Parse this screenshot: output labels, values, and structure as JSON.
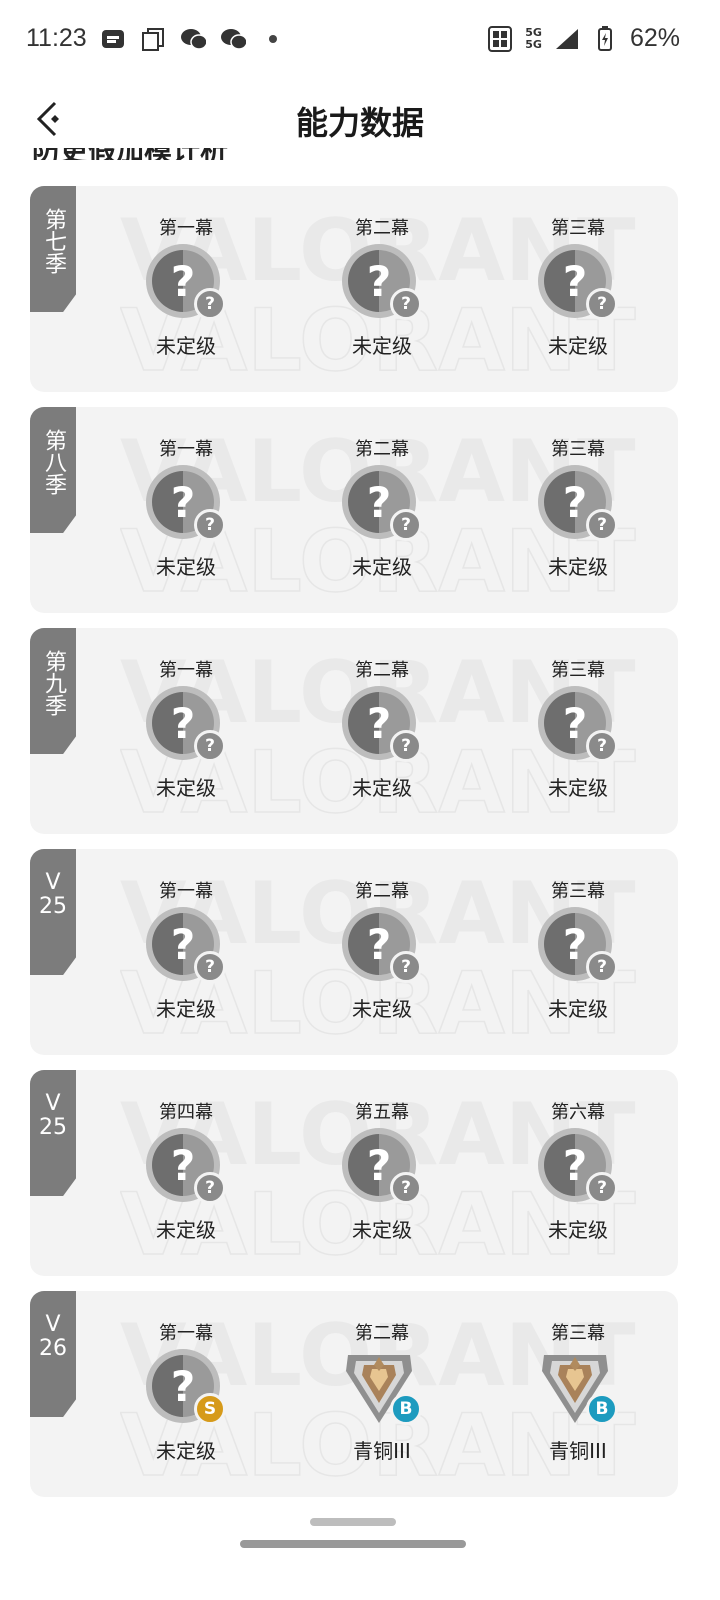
{
  "status": {
    "time": "11:23",
    "battery": "62%",
    "net_top": "5G",
    "net_bottom": "5G",
    "icons": [
      "notification-b-icon",
      "copy-icon",
      "wechat-icon",
      "wechat-icon",
      "dot-icon"
    ]
  },
  "header": {
    "title": "能力数据",
    "cut_text": "防更假加模计析"
  },
  "watermark": "VALORANT",
  "seasons": [
    {
      "tag": "第七季",
      "acts": [
        {
          "label": "第一幕",
          "rank": "未定级",
          "badge": "?"
        },
        {
          "label": "第二幕",
          "rank": "未定级",
          "badge": "?"
        },
        {
          "label": "第三幕",
          "rank": "未定级",
          "badge": "?"
        }
      ]
    },
    {
      "tag": "第八季",
      "acts": [
        {
          "label": "第一幕",
          "rank": "未定级",
          "badge": "?"
        },
        {
          "label": "第二幕",
          "rank": "未定级",
          "badge": "?"
        },
        {
          "label": "第三幕",
          "rank": "未定级",
          "badge": "?"
        }
      ]
    },
    {
      "tag": "第九季",
      "acts": [
        {
          "label": "第一幕",
          "rank": "未定级",
          "badge": "?"
        },
        {
          "label": "第二幕",
          "rank": "未定级",
          "badge": "?"
        },
        {
          "label": "第三幕",
          "rank": "未定级",
          "badge": "?"
        }
      ]
    },
    {
      "tag": "V 25",
      "acts": [
        {
          "label": "第一幕",
          "rank": "未定级",
          "badge": "?"
        },
        {
          "label": "第二幕",
          "rank": "未定级",
          "badge": "?"
        },
        {
          "label": "第三幕",
          "rank": "未定级",
          "badge": "?"
        }
      ]
    },
    {
      "tag": "V 25",
      "acts": [
        {
          "label": "第四幕",
          "rank": "未定级",
          "badge": "?"
        },
        {
          "label": "第五幕",
          "rank": "未定级",
          "badge": "?"
        },
        {
          "label": "第六幕",
          "rank": "未定级",
          "badge": "?"
        }
      ]
    },
    {
      "tag": "V 26",
      "acts": [
        {
          "label": "第一幕",
          "rank": "未定级",
          "badge": "S"
        },
        {
          "label": "第二幕",
          "rank": "青铜III",
          "badge": "B"
        },
        {
          "label": "第三幕",
          "rank": "青铜III",
          "badge": "B"
        }
      ]
    }
  ]
}
